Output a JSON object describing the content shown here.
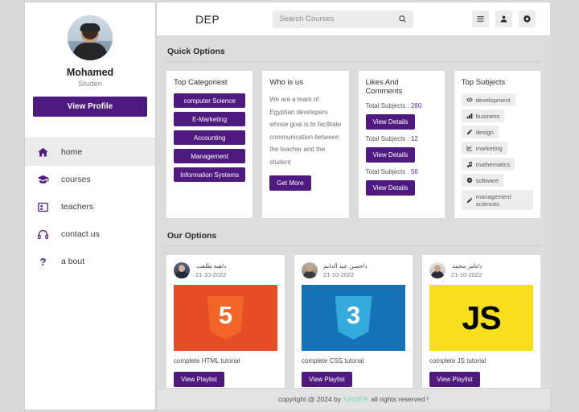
{
  "sidebar": {
    "profile": {
      "avatar_icon": "user-photo-avatar",
      "name": "Mohamed",
      "role": "Studen",
      "view_profile_label": "View Profile"
    },
    "nav_items": [
      {
        "label": "home",
        "icon": "home-icon",
        "active": true
      },
      {
        "label": "courses",
        "icon": "graduation-cap-icon",
        "active": false
      },
      {
        "label": "teachers",
        "icon": "teacher-board-icon",
        "active": false
      },
      {
        "label": "contact us",
        "icon": "headset-icon",
        "active": false
      },
      {
        "label": "a bout",
        "icon": "question-mark-icon",
        "active": false
      }
    ]
  },
  "header": {
    "logo": "DEP",
    "search": {
      "placeholder": "Search Courses",
      "value": "",
      "icon": "search-icon"
    },
    "buttons": [
      {
        "icon": "hamburger-menu-icon",
        "name": "menu-toggle-button"
      },
      {
        "icon": "user-icon",
        "name": "profile-button"
      },
      {
        "icon": "gear-icon",
        "name": "settings-button"
      }
    ]
  },
  "quick_options": {
    "section_title": "Quick Options",
    "top_categories": {
      "title": "Top Categoriest",
      "items": [
        "computer Science",
        "E-Marketing",
        "Accounting",
        "Management",
        "Information Systems"
      ]
    },
    "who_is_us": {
      "title": "Who is us",
      "body": "We are a team of Egyptian developers whose goal is to facilitate communication between the teacher and the student",
      "button_label": "Get More"
    },
    "likes_and_comments": {
      "title": "Likes And Comments",
      "stats": [
        {
          "label": "Total Subjects : ",
          "value": "280",
          "button_label": "View Details"
        },
        {
          "label": "Total Subjects : ",
          "value": "12",
          "button_label": "View Details"
        },
        {
          "label": "Total Subjects : ",
          "value": "56",
          "button_label": "View Details"
        }
      ]
    },
    "top_subjects": {
      "title": "Top Subjects",
      "tags": [
        {
          "label": "development",
          "icon": "code-icon"
        },
        {
          "label": "business",
          "icon": "bar-chart-icon"
        },
        {
          "label": "design",
          "icon": "pencil-icon"
        },
        {
          "label": "marketing",
          "icon": "line-chart-icon"
        },
        {
          "label": "mathematics",
          "icon": "music-note-icon"
        },
        {
          "label": "software",
          "icon": "gear-icon"
        },
        {
          "label": "management sciences",
          "icon": "pencil-icon"
        }
      ]
    }
  },
  "our_options": {
    "section_title": "Our Options",
    "cards": [
      {
        "author": "د/هبة طلعت",
        "date": "21-10-2022",
        "thumb_label": "5",
        "thumb_kind": "html",
        "title": "complete HTML tutorial",
        "button_label": "View Playlist"
      },
      {
        "author": "د/حسن عبد الدايم",
        "date": "21-10-2022",
        "thumb_label": "3",
        "thumb_kind": "css",
        "title": "complete CSS tutorial",
        "button_label": "View Playlist"
      },
      {
        "author": "د/تامر محمد",
        "date": "21-10-2022",
        "thumb_label": "JS",
        "thumb_kind": "js",
        "title": "complete JS tutorial",
        "button_label": "View Playlist"
      }
    ]
  },
  "footer": {
    "prefix": "copyright @ 2024 by",
    "brand": "KAISER",
    "suffix": "all rights reserved !",
    "brand_color": "#6fe0b0"
  },
  "theme": {
    "purple": "#4e1a7f",
    "accent_num": "#6a2a9e"
  }
}
